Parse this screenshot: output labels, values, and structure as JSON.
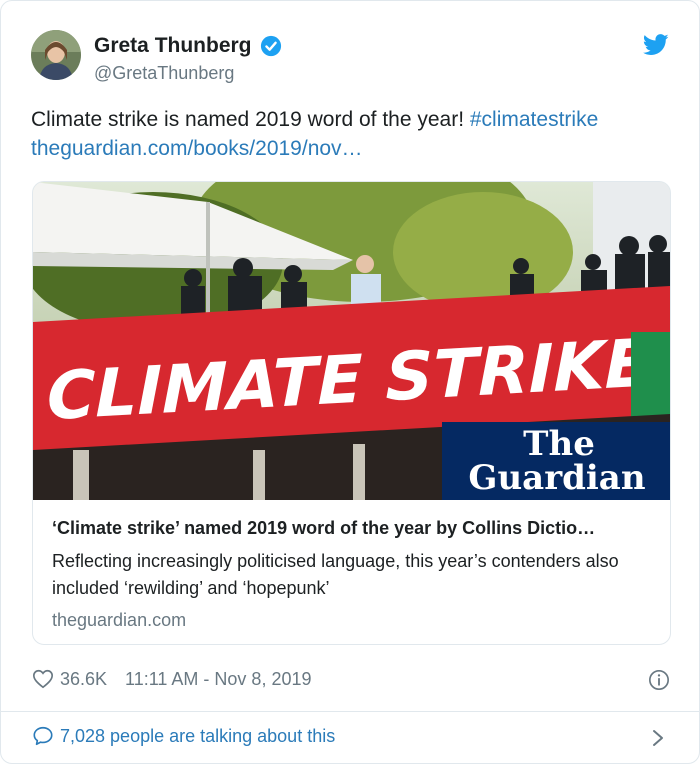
{
  "author": {
    "name": "Greta Thunberg",
    "handle": "@GretaThunberg"
  },
  "tweet": {
    "text": "Climate strike is named 2019 word of the year! ",
    "hashtag": "#climatestrike",
    "link": "theguardian.com/books/2019/nov…"
  },
  "card": {
    "image": {
      "banner_text": "CLIMATE STRIKE",
      "logo_line1": "The",
      "logo_line2": "Guardian"
    },
    "title": "‘Climate strike’ named 2019 word of the year by Collins Dictio…",
    "description": "Reflecting increasingly politicised language, this year’s contenders also included ‘rewilding’ and ‘hopepunk’",
    "domain": "theguardian.com"
  },
  "meta": {
    "likes": "36.6K",
    "timestamp": "11:11 AM - Nov 8, 2019"
  },
  "footer": {
    "talking": "7,028 people are talking about this"
  },
  "colors": {
    "link": "#2b7bb9",
    "verified": "#1da1f2",
    "banner_red": "#d7282f",
    "guardian_blue": "#052962"
  }
}
